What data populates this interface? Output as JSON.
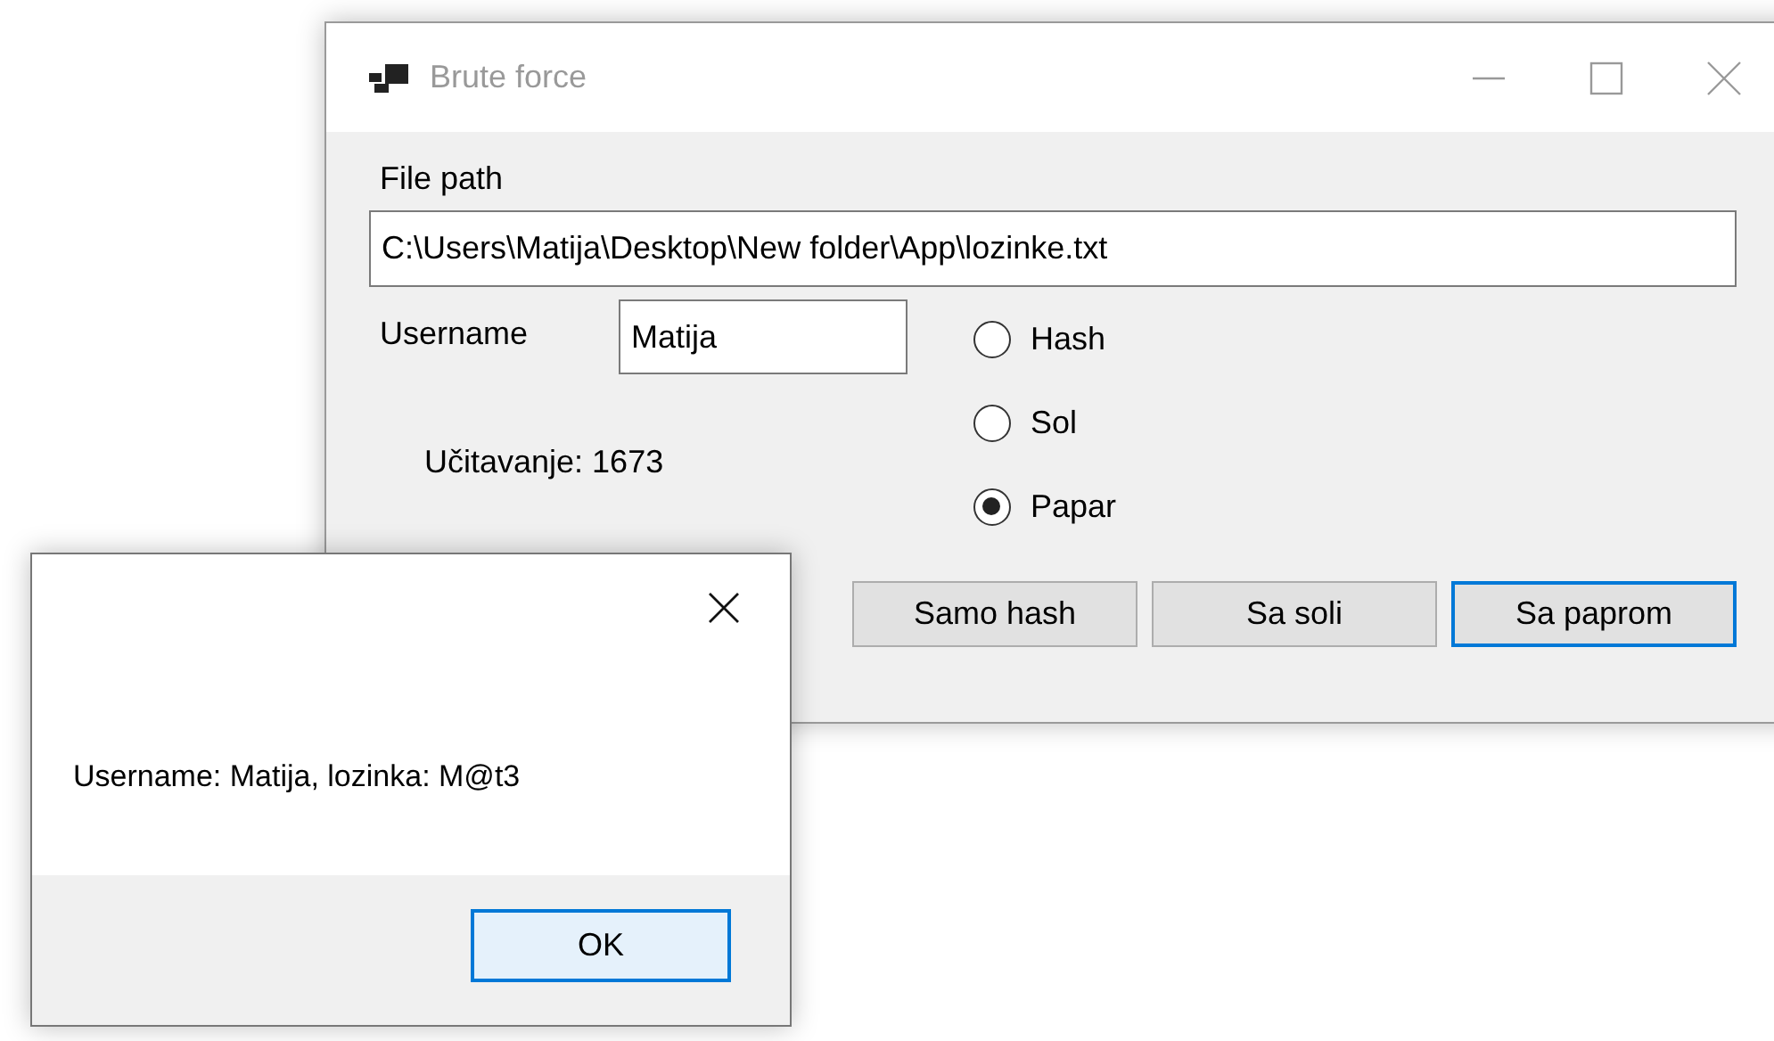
{
  "main_window": {
    "title": "Brute force",
    "file_path": {
      "label": "File path",
      "value": "C:\\Users\\Matija\\Desktop\\New folder\\App\\lozinke.txt"
    },
    "username": {
      "label": "Username",
      "value": "Matija"
    },
    "modes": [
      {
        "label": "Hash",
        "selected": false
      },
      {
        "label": "Sol",
        "selected": false
      },
      {
        "label": "Papar",
        "selected": true
      }
    ],
    "progress_text": "Učitavanje: 1673",
    "buttons": [
      {
        "label": "Samo hash",
        "focused": false
      },
      {
        "label": "Sa soli",
        "focused": false
      },
      {
        "label": "Sa paprom",
        "focused": true
      }
    ]
  },
  "message_box": {
    "text": "Username: Matija, lozinka: M@t3",
    "button": "OK"
  }
}
